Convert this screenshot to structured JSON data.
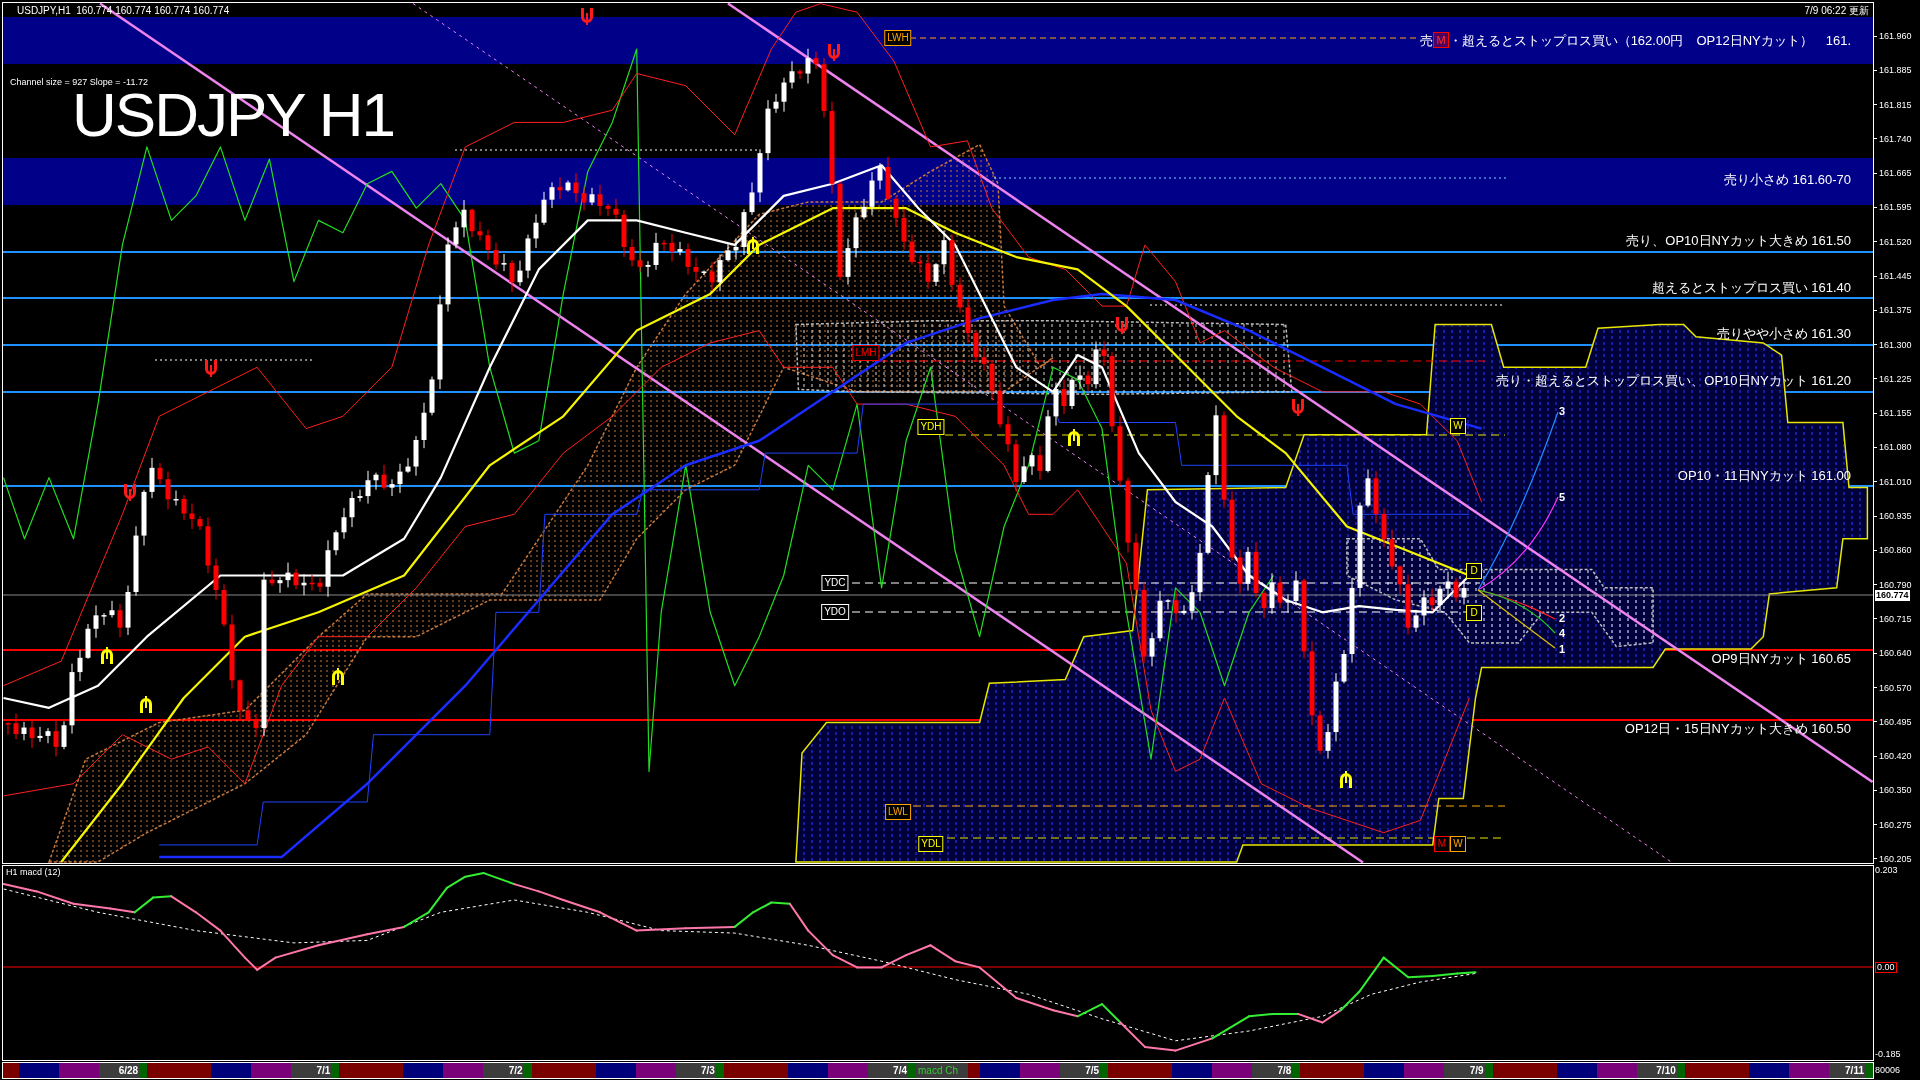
{
  "header": {
    "symbol_quote": "USDJPY,H1  160.774 160.774 160.774 160.774",
    "updated": "7/9 06:22 更新"
  },
  "channel_info": "Channel size = 927 Slope = -11.72",
  "chart_title": "USDJPY H1",
  "level_notes": [
    {
      "kind": "band",
      "lead": "売",
      "badge": "M",
      "text": "・超えるとストップロス買い（162.00円　OP12日NYカット）　161.",
      "color": "#000088"
    },
    {
      "kind": "band",
      "text": "売り小さめ 161.60-70",
      "color": "#000088"
    },
    {
      "kind": "line",
      "text": "売り、OP10日NYカット大きめ 161.50",
      "color": "#1e90ff"
    },
    {
      "kind": "line",
      "text": "超えるとストップロス買い 161.40",
      "color": "#1e90ff"
    },
    {
      "kind": "line",
      "text": "売りやや小さめ 161.30",
      "color": "#1e90ff"
    },
    {
      "kind": "line",
      "text": "売り・超えるとストップロス買い、OP10日NYカット 161.20",
      "color": "#1e90ff"
    },
    {
      "kind": "line",
      "text": "OP10・11日NYカット 161.00",
      "color": "#1e90ff"
    },
    {
      "kind": "line",
      "text": "OP9日NYカット 160.65",
      "color": "#ff0000"
    },
    {
      "kind": "line",
      "text": "OP12日・15日NYカット大きめ 160.50",
      "color": "#ff0000"
    }
  ],
  "chart_labels": [
    {
      "text": "LWH",
      "color": "#ffa500"
    },
    {
      "text": "LMH",
      "color": "#ff0000"
    },
    {
      "text": "YDH",
      "color": "#ffff00"
    },
    {
      "text": "YDC",
      "color": "#ffffff"
    },
    {
      "text": "YDO",
      "color": "#ffffff"
    },
    {
      "text": "LWL",
      "color": "#ffa500"
    },
    {
      "text": "YDL",
      "color": "#ffff00"
    },
    {
      "text": "W",
      "color": "#ffff00"
    },
    {
      "text": "D",
      "color": "#ffff00"
    },
    {
      "text": "D",
      "color": "#ffff00"
    },
    {
      "text": "M",
      "color": "#ff0000"
    },
    {
      "text": "W",
      "color": "#ffa500"
    }
  ],
  "projection_labels": [
    "3",
    "5",
    "2",
    "4",
    "1"
  ],
  "price_axis": {
    "ticks": [
      "161.960",
      "161.885",
      "161.815",
      "161.740",
      "161.665",
      "161.595",
      "161.520",
      "161.445",
      "161.375",
      "161.300",
      "161.225",
      "161.155",
      "161.080",
      "161.010",
      "160.935",
      "160.860",
      "160.790",
      "160.715",
      "160.640",
      "160.570",
      "160.495",
      "160.420",
      "160.350",
      "160.275",
      "160.205"
    ],
    "current": "160.774"
  },
  "macd": {
    "title": "H1 macd (12)",
    "ticks": [
      "0.203",
      "0.00",
      "-0.185"
    ]
  },
  "time_axis": {
    "labels": [
      "6/28",
      "7/1",
      "7/2",
      "7/3",
      "7/4",
      "7/5",
      "7/8",
      "7/9",
      "7/10",
      "7/11"
    ],
    "overlay": "macd Ch"
  },
  "corner_label": "80006"
}
